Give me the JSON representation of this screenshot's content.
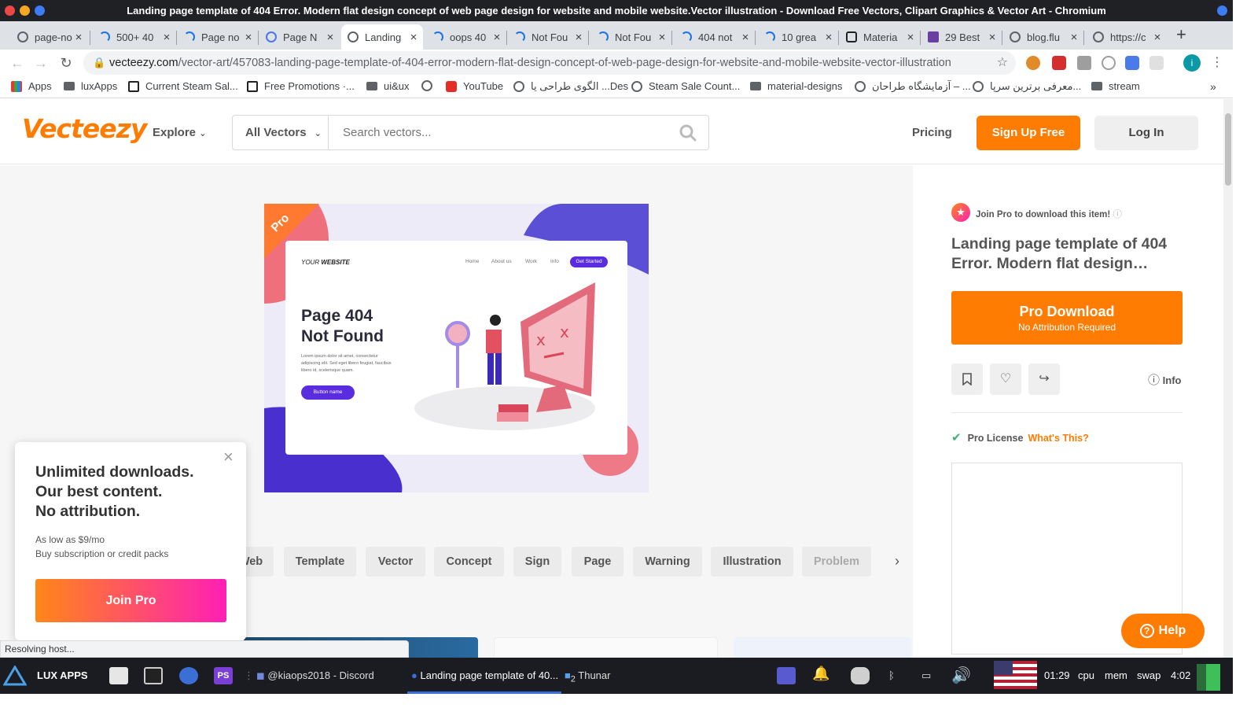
{
  "window": {
    "title": "Landing page template of 404 Error. Modern flat design concept of web page design for website and mobile website.Vector illustration - Download Free Vectors, Clipart Graphics & Vector Art - Chromium"
  },
  "tabs": [
    {
      "label": "page-no"
    },
    {
      "label": "500+ 40"
    },
    {
      "label": "Page no"
    },
    {
      "label": "Page N"
    },
    {
      "label": "Landing"
    },
    {
      "label": "oops 40"
    },
    {
      "label": "Not Fou"
    },
    {
      "label": "Not Fou"
    },
    {
      "label": "404 not"
    },
    {
      "label": "10 grea"
    },
    {
      "label": "Materia"
    },
    {
      "label": "29 Best"
    },
    {
      "label": "blog.flu"
    },
    {
      "label": "https://c"
    }
  ],
  "address": {
    "domain": "vecteezy.com",
    "path": "/vector-art/457083-landing-page-template-of-404-error-modern-flat-design-concept-of-web-page-design-for-website-and-mobile-website-vector-illustration"
  },
  "bookmarks": [
    {
      "label": "Apps"
    },
    {
      "label": "luxApps"
    },
    {
      "label": "Current Steam Sal..."
    },
    {
      "label": "Free Promotions ·..."
    },
    {
      "label": "ui&ux"
    },
    {
      "label": "YouTube"
    },
    {
      "label": "الگوی طراحی یا ...Des"
    },
    {
      "label": "Steam Sale Count..."
    },
    {
      "label": "material-designs"
    },
    {
      "label": "آزمایشگاه طراحان – ..."
    },
    {
      "label": "معرفی برترین سرپا..."
    },
    {
      "label": "stream"
    }
  ],
  "site": {
    "logo": "Vecteezy",
    "explore": "Explore",
    "category": "All Vectors",
    "search_placeholder": "Search vectors...",
    "pricing": "Pricing",
    "signup": "Sign Up Free",
    "login": "Log In"
  },
  "preview": {
    "ribbon": "Pro",
    "brand_prefix": "YOUR ",
    "brand_suffix": "WEBSITE",
    "nav": [
      "Home",
      "About us",
      "Work",
      "Info"
    ],
    "cta": "Get Started",
    "heading_line1": "Page 404",
    "heading_line2": "Not Found",
    "body_line1": "Lorem ipsum dolor sit amet, consectetur",
    "body_line2": "adipiscing elit. Sed eget libero feugiat, faucibus",
    "body_line3": "libero id, scelerisque quam.",
    "button": "Button name"
  },
  "tags": [
    "Web",
    "Template",
    "Vector",
    "Concept",
    "Sign",
    "Page",
    "Warning",
    "Illustration",
    "Problem"
  ],
  "right_panel": {
    "join_note": "Join Pro to download this item!",
    "title": "Landing page template of 404 Error. Modern flat design…",
    "download_main": "Pro Download",
    "download_sub": "No Attribution Required",
    "info": "Info",
    "license": "Pro License",
    "whats_this": "What's This?"
  },
  "popup": {
    "line1": "Unlimited downloads.",
    "line2": "Our best content.",
    "line3": "No attribution.",
    "price1": "As low as $9/mo",
    "price2": "Buy subscription or credit packs",
    "button": "Join Pro"
  },
  "help": "Help",
  "status": "Resolving host...",
  "taskbar": {
    "launcher": "LUX APPS",
    "discord": "@kiaops2018 - Discord",
    "chromium": "Landing page template of 40...",
    "thunar": "Thunar",
    "thunar_count": "2",
    "time": "01:29",
    "cpu": "cpu",
    "mem": "mem",
    "swap": "swap",
    "time2": "4:02"
  },
  "colors": {
    "brand_orange": "#ff7c02",
    "join_gradient_start": "#ff8717",
    "join_gradient_end": "#ff1fb5"
  }
}
